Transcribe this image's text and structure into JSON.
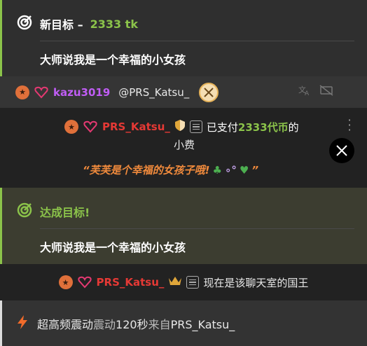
{
  "goal_new": {
    "title_prefix": "新目标 –",
    "amount": "2333 tk",
    "description": "大师说我是一个幸福的小女孩"
  },
  "mention_bar": {
    "username": "kazu3019",
    "mention": "@PRS_Katsu_"
  },
  "tip_message": {
    "username": "PRS_Katsu_",
    "paid_prefix": "已支付",
    "amount": "2333代币",
    "paid_suffix": "的",
    "line2": "小费",
    "quote": "“芙芙是个幸福的女孩子哦!",
    "quote_end": "”"
  },
  "goal_reached": {
    "title": "达成目标!",
    "description": "大师说我是一个幸福的小女孩"
  },
  "king_message": {
    "username": "PRS_Katsu_",
    "text": "现在是该聊天室的国王"
  },
  "vibration": {
    "prefix": "超高频震动",
    "dur_prefix": "震动",
    "seconds": "120秒",
    "from": "来自",
    "username": "PRS_Katsu_"
  },
  "colors": {
    "goal_accent": "#8bc34a",
    "username_purple": "#c05df5",
    "username_red": "#e53935",
    "quote_orange": "#f08a3c",
    "badge_orange": "#e0703a"
  }
}
